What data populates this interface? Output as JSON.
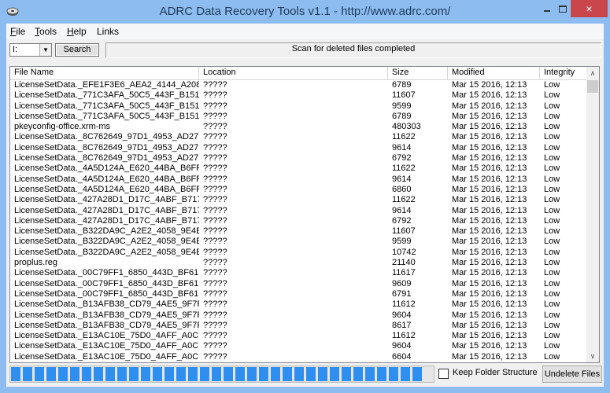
{
  "window": {
    "title": "ADRC Data Recovery Tools v1.1 - http://www.adrc.com/",
    "app_icon": "disk-recovery-icon",
    "controls": {
      "minimize": "minimize-icon",
      "maximize": "maximize-icon",
      "close": "×"
    }
  },
  "menu": [
    {
      "label": "File",
      "accel": "F",
      "rest": "ile"
    },
    {
      "label": "Tools",
      "accel": "T",
      "rest": "ools"
    },
    {
      "label": "Help",
      "accel": "H",
      "rest": "elp"
    },
    {
      "label": "Links",
      "accel": "",
      "rest": "Links"
    }
  ],
  "toolbar": {
    "drive_value": "I:",
    "search_label": "Search",
    "status": "Scan for deleted files completed"
  },
  "table": {
    "columns": [
      "File Name",
      "Location",
      "Size",
      "Modified",
      "Integrity"
    ],
    "rows": [
      [
        "LicenseSetData._EFE1F3E6_AEA2_4144_A208...",
        "?????",
        "6789",
        "Mar 15 2016, 12:13",
        "Low"
      ],
      [
        "LicenseSetData._771C3AFA_50C5_443F_B151...",
        "?????",
        "11607",
        "Mar 15 2016, 12:13",
        "Low"
      ],
      [
        "LicenseSetData._771C3AFA_50C5_443F_B151...",
        "?????",
        "9599",
        "Mar 15 2016, 12:13",
        "Low"
      ],
      [
        "LicenseSetData._771C3AFA_50C5_443F_B151...",
        "?????",
        "6789",
        "Mar 15 2016, 12:13",
        "Low"
      ],
      [
        "pkeyconfig-office.xrm-ms",
        "?????",
        "480303",
        "Mar 15 2016, 12:13",
        "Low"
      ],
      [
        "LicenseSetData._8C762649_97D1_4953_AD27...",
        "?????",
        "11622",
        "Mar 15 2016, 12:13",
        "Low"
      ],
      [
        "LicenseSetData._8C762649_97D1_4953_AD27...",
        "?????",
        "9614",
        "Mar 15 2016, 12:13",
        "Low"
      ],
      [
        "LicenseSetData._8C762649_97D1_4953_AD27...",
        "?????",
        "6792",
        "Mar 15 2016, 12:13",
        "Low"
      ],
      [
        "LicenseSetData._4A5D124A_E620_44BA_B6FF...",
        "?????",
        "11622",
        "Mar 15 2016, 12:13",
        "Low"
      ],
      [
        "LicenseSetData._4A5D124A_E620_44BA_B6FF...",
        "?????",
        "9614",
        "Mar 15 2016, 12:13",
        "Low"
      ],
      [
        "LicenseSetData._4A5D124A_E620_44BA_B6FF...",
        "?????",
        "6860",
        "Mar 15 2016, 12:13",
        "Low"
      ],
      [
        "LicenseSetData._427A28D1_D17C_4ABF_B717...",
        "?????",
        "11622",
        "Mar 15 2016, 12:13",
        "Low"
      ],
      [
        "LicenseSetData._427A28D1_D17C_4ABF_B717...",
        "?????",
        "9614",
        "Mar 15 2016, 12:13",
        "Low"
      ],
      [
        "LicenseSetData._427A28D1_D17C_4ABF_B717...",
        "?????",
        "6792",
        "Mar 15 2016, 12:13",
        "Low"
      ],
      [
        "LicenseSetData._B322DA9C_A2E2_4058_9E4E...",
        "?????",
        "11607",
        "Mar 15 2016, 12:13",
        "Low"
      ],
      [
        "LicenseSetData._B322DA9C_A2E2_4058_9E4E...",
        "?????",
        "9599",
        "Mar 15 2016, 12:13",
        "Low"
      ],
      [
        "LicenseSetData._B322DA9C_A2E2_4058_9E4E...",
        "?????",
        "10742",
        "Mar 15 2016, 12:13",
        "Low"
      ],
      [
        "proplus.reg",
        "?????",
        "21140",
        "Mar 15 2016, 12:13",
        "Low"
      ],
      [
        "LicenseSetData._00C79FF1_6850_443D_BF61...",
        "?????",
        "11617",
        "Mar 15 2016, 12:13",
        "Low"
      ],
      [
        "LicenseSetData._00C79FF1_6850_443D_BF61...",
        "?????",
        "9609",
        "Mar 15 2016, 12:13",
        "Low"
      ],
      [
        "LicenseSetData._00C79FF1_6850_443D_BF61...",
        "?????",
        "6791",
        "Mar 15 2016, 12:13",
        "Low"
      ],
      [
        "LicenseSetData._B13AFB38_CD79_4AE5_9F7F...",
        "?????",
        "11612",
        "Mar 15 2016, 12:13",
        "Low"
      ],
      [
        "LicenseSetData._B13AFB38_CD79_4AE5_9F7F...",
        "?????",
        "9604",
        "Mar 15 2016, 12:13",
        "Low"
      ],
      [
        "LicenseSetData._B13AFB38_CD79_4AE5_9F7F...",
        "?????",
        "8617",
        "Mar 15 2016, 12:13",
        "Low"
      ],
      [
        "LicenseSetData._E13AC10E_75D0_4AFF_A0C...",
        "?????",
        "11612",
        "Mar 15 2016, 12:13",
        "Low"
      ],
      [
        "LicenseSetData._E13AC10E_75D0_4AFF_A0C...",
        "?????",
        "9604",
        "Mar 15 2016, 12:13",
        "Low"
      ],
      [
        "LicenseSetData._E13AC10E_75D0_4AFF_A0C...",
        "?????",
        "6604",
        "Mar 15 2016, 12:13",
        "Low"
      ]
    ]
  },
  "bottom": {
    "progress_percent": 100,
    "keep_folder_label": "Keep Folder Structure",
    "keep_folder_checked": false,
    "undelete_label": "Undelete Files"
  },
  "colors": {
    "titlebar": "#8dbdf0",
    "close_button": "#c9464a",
    "progress_fill": "#2e8ff0"
  }
}
